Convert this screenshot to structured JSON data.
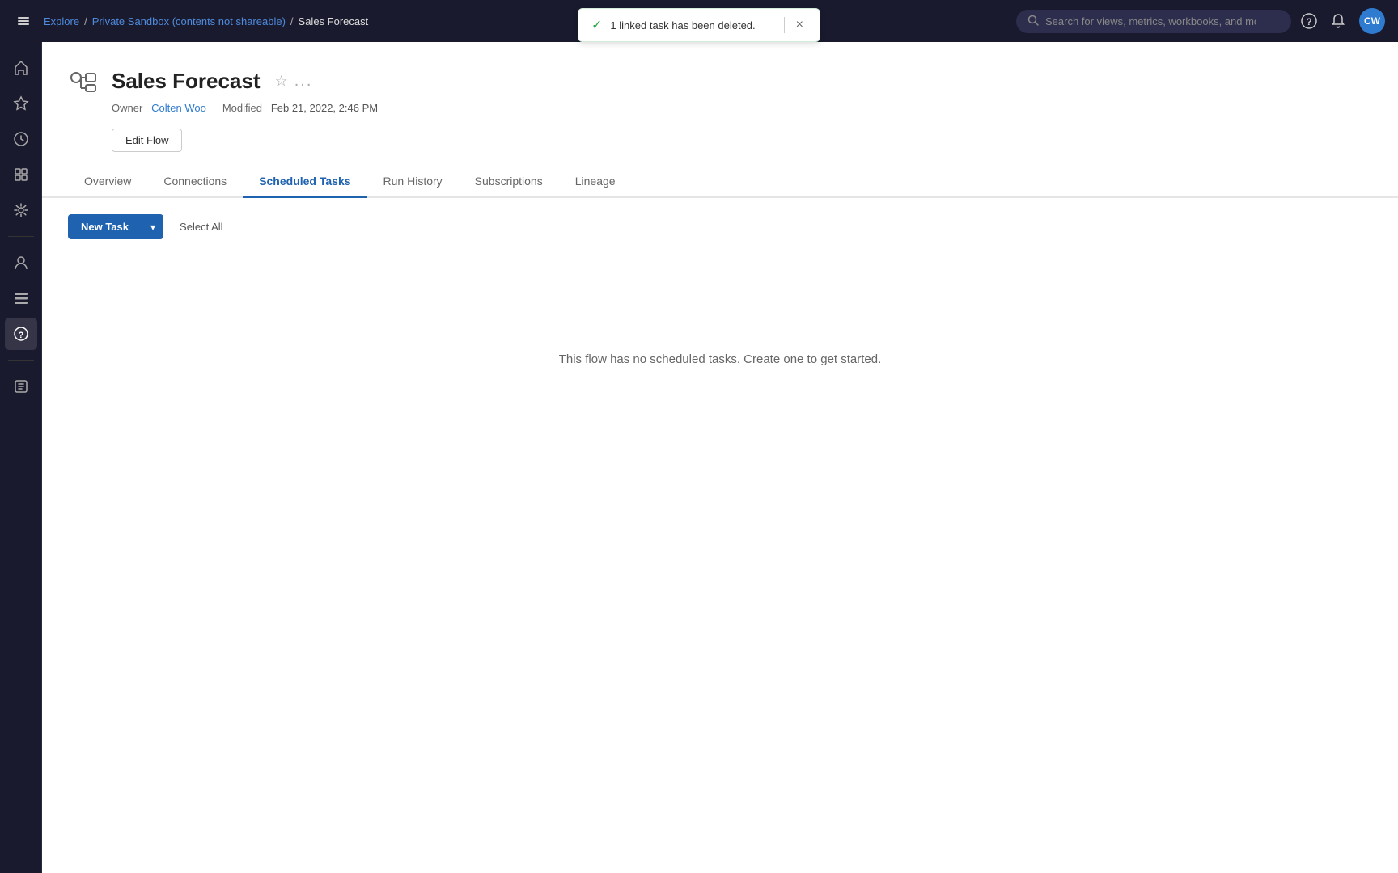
{
  "topNav": {
    "toggleLabel": "☰",
    "breadcrumbs": [
      {
        "label": "Explore",
        "href": "#"
      },
      {
        "label": "Private Sandbox (contents not shareable)",
        "href": "#"
      },
      {
        "label": "Sales Forecast",
        "href": null
      }
    ],
    "searchPlaceholder": "Search for views, metrics, workbooks, and more",
    "helpLabel": "?",
    "notificationsLabel": "🔔",
    "avatarInitials": "CW"
  },
  "toast": {
    "message": "1 linked task has been deleted.",
    "closeLabel": "×"
  },
  "sidebar": {
    "items": [
      {
        "name": "home",
        "icon": "⌂",
        "active": false
      },
      {
        "name": "favorites",
        "icon": "★",
        "active": false
      },
      {
        "name": "recents",
        "icon": "🕐",
        "active": false
      },
      {
        "name": "collections",
        "icon": "⊞",
        "active": false
      },
      {
        "name": "recommendations",
        "icon": "💡",
        "active": false
      },
      {
        "name": "divider1"
      },
      {
        "name": "user",
        "icon": "👤",
        "active": false
      },
      {
        "name": "groups",
        "icon": "⊞",
        "active": false
      },
      {
        "name": "help",
        "icon": "?",
        "active": true
      },
      {
        "name": "divider2"
      },
      {
        "name": "tasks",
        "icon": "☰",
        "active": false
      }
    ]
  },
  "page": {
    "title": "Sales Forecast",
    "owner": {
      "label": "Owner",
      "name": "Colten Woo"
    },
    "modified": {
      "label": "Modified",
      "value": "Feb 21, 2022, 2:46 PM"
    },
    "editFlowLabel": "Edit Flow",
    "starLabel": "☆",
    "moreLabel": "..."
  },
  "tabs": [
    {
      "id": "overview",
      "label": "Overview",
      "active": false
    },
    {
      "id": "connections",
      "label": "Connections",
      "active": false
    },
    {
      "id": "scheduled-tasks",
      "label": "Scheduled Tasks",
      "active": true
    },
    {
      "id": "run-history",
      "label": "Run History",
      "active": false
    },
    {
      "id": "subscriptions",
      "label": "Subscriptions",
      "active": false
    },
    {
      "id": "lineage",
      "label": "Lineage",
      "active": false
    }
  ],
  "scheduledTasks": {
    "newTaskLabel": "New Task",
    "dropdownLabel": "▾",
    "selectAllLabel": "Select All",
    "emptyMessage": "This flow has no scheduled tasks. Create one to get started."
  }
}
